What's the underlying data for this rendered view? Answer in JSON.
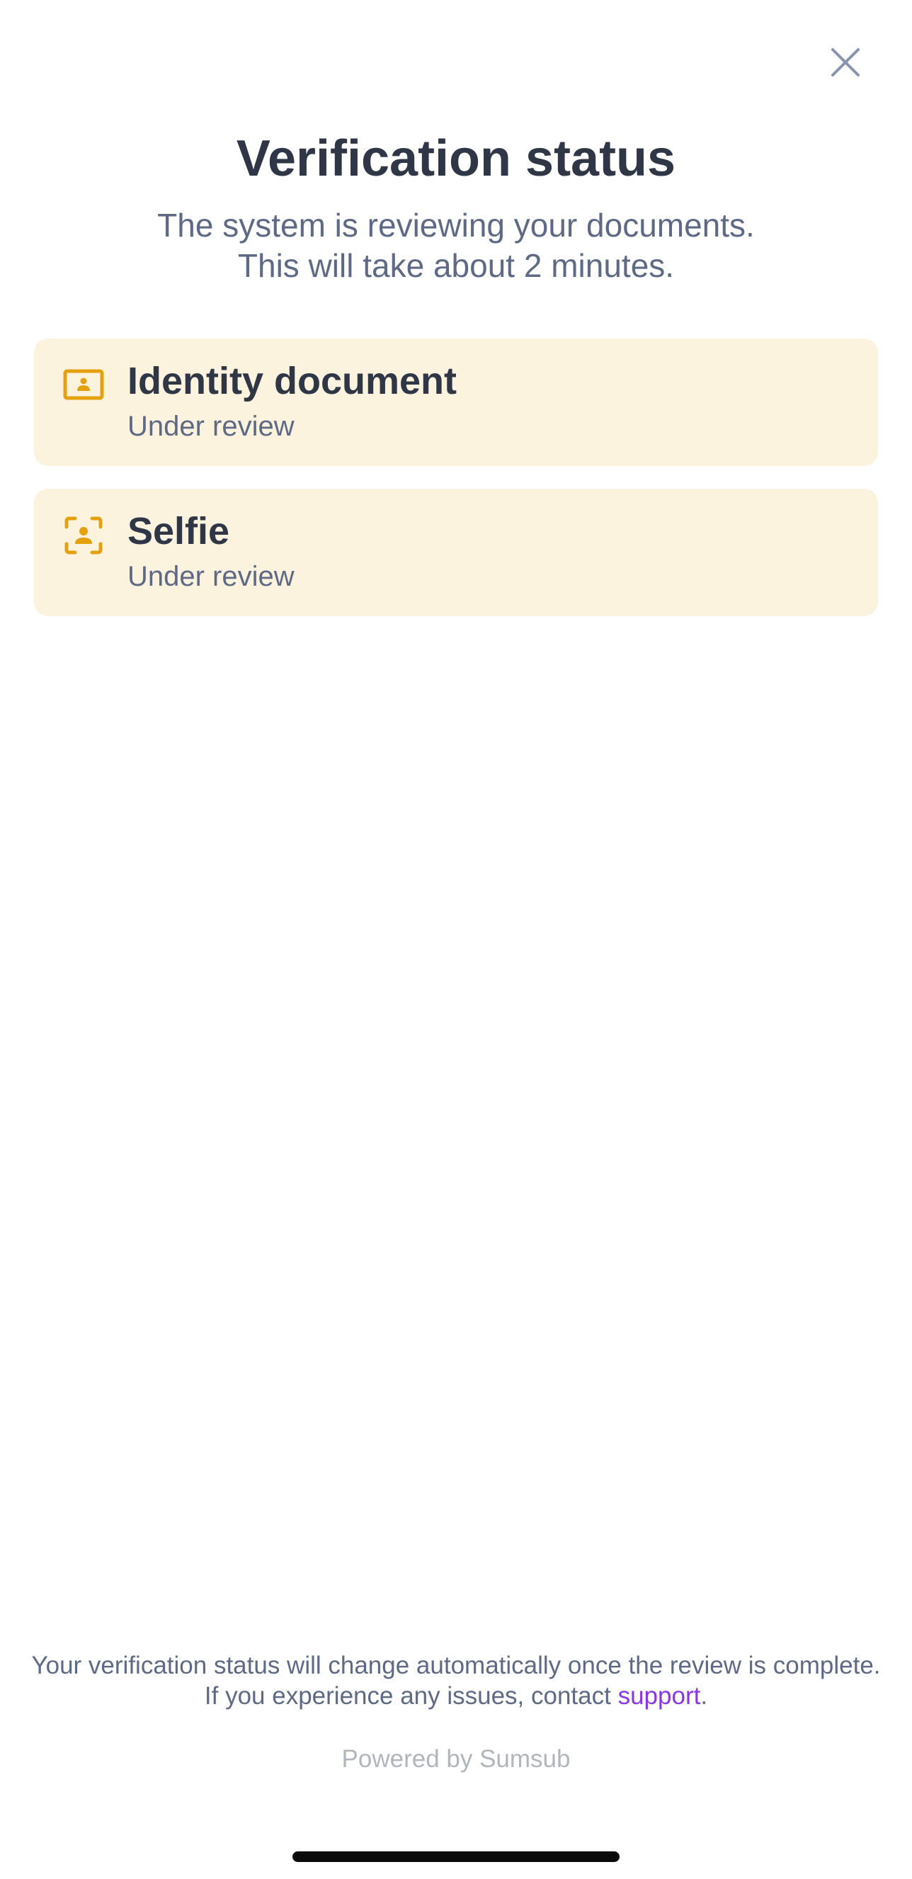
{
  "header": {
    "close_icon": "close-icon",
    "title": "Verification status",
    "subtitle_line1": "The system is reviewing your documents.",
    "subtitle_line2": "This will take about 2 minutes."
  },
  "steps": [
    {
      "icon": "id-card-icon",
      "title": "Identity document",
      "status": "Under review"
    },
    {
      "icon": "face-scan-icon",
      "title": "Selfie",
      "status": "Under review"
    }
  ],
  "footer": {
    "note_before_link": "Your verification status will change automatically once the review is complete. If you experience any issues, contact ",
    "link_text": "support",
    "note_after_link": ".",
    "powered_by": "Powered by Sumsub"
  },
  "colors": {
    "title": "#2f3747",
    "muted_text": "#5e6a85",
    "card_background": "#fcf3df",
    "status_icon": "#e5a00d",
    "link": "#8a35e6",
    "powered_by": "#b1b5be",
    "close_icon": "#8993ad"
  }
}
